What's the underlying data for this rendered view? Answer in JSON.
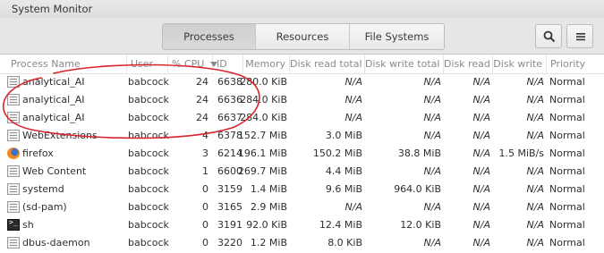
{
  "window": {
    "title": "System Monitor"
  },
  "tabs": [
    {
      "label": "Processes",
      "active": true
    },
    {
      "label": "Resources",
      "active": false
    },
    {
      "label": "File Systems",
      "active": false
    }
  ],
  "toolbar": {
    "search_icon": "search-icon",
    "menu_icon": "hamburger-menu-icon"
  },
  "columns": {
    "name": "Process Name",
    "user": "User",
    "cpu": "% CPU",
    "cpu_sort_icon": "sort-desc-icon",
    "id": "ID",
    "memory": "Memory",
    "disk_read_total": "Disk read total",
    "disk_write_total": "Disk write total",
    "disk_read": "Disk read",
    "disk_write": "Disk write",
    "priority": "Priority"
  },
  "processes": [
    {
      "icon": "generic-app-icon",
      "name": "analytical_AI",
      "user": "babcock",
      "cpu": "24",
      "id": "6638",
      "memory": "280.0 KiB",
      "disk_read_total": "N/A",
      "disk_write_total": "N/A",
      "disk_read": "N/A",
      "disk_write": "N/A",
      "priority": "Normal"
    },
    {
      "icon": "generic-app-icon",
      "name": "analytical_AI",
      "user": "babcock",
      "cpu": "24",
      "id": "6636",
      "memory": "284.0 KiB",
      "disk_read_total": "N/A",
      "disk_write_total": "N/A",
      "disk_read": "N/A",
      "disk_write": "N/A",
      "priority": "Normal"
    },
    {
      "icon": "generic-app-icon",
      "name": "analytical_AI",
      "user": "babcock",
      "cpu": "24",
      "id": "6637",
      "memory": "284.0 KiB",
      "disk_read_total": "N/A",
      "disk_write_total": "N/A",
      "disk_read": "N/A",
      "disk_write": "N/A",
      "priority": "Normal"
    },
    {
      "icon": "generic-app-icon",
      "name": "WebExtensions",
      "user": "babcock",
      "cpu": "4",
      "id": "6378",
      "memory": "152.7 MiB",
      "disk_read_total": "3.0 MiB",
      "disk_write_total": "N/A",
      "disk_read": "N/A",
      "disk_write": "N/A",
      "priority": "Normal"
    },
    {
      "icon": "firefox-icon",
      "name": "firefox",
      "user": "babcock",
      "cpu": "3",
      "id": "6214",
      "memory": "196.1 MiB",
      "disk_read_total": "150.2 MiB",
      "disk_write_total": "38.8 MiB",
      "disk_read": "N/A",
      "disk_write": "1.5 MiB/s",
      "priority": "Normal"
    },
    {
      "icon": "generic-app-icon",
      "name": "Web Content",
      "user": "babcock",
      "cpu": "1",
      "id": "6600",
      "memory": "269.7 MiB",
      "disk_read_total": "4.4 MiB",
      "disk_write_total": "N/A",
      "disk_read": "N/A",
      "disk_write": "N/A",
      "priority": "Normal"
    },
    {
      "icon": "generic-app-icon",
      "name": "systemd",
      "user": "babcock",
      "cpu": "0",
      "id": "3159",
      "memory": "1.4 MiB",
      "disk_read_total": "9.6 MiB",
      "disk_write_total": "964.0 KiB",
      "disk_read": "N/A",
      "disk_write": "N/A",
      "priority": "Normal"
    },
    {
      "icon": "generic-app-icon",
      "name": "(sd-pam)",
      "user": "babcock",
      "cpu": "0",
      "id": "3165",
      "memory": "2.9 MiB",
      "disk_read_total": "N/A",
      "disk_write_total": "N/A",
      "disk_read": "N/A",
      "disk_write": "N/A",
      "priority": "Normal"
    },
    {
      "icon": "terminal-icon",
      "name": "sh",
      "user": "babcock",
      "cpu": "0",
      "id": "3191",
      "memory": "92.0 KiB",
      "disk_read_total": "12.4 MiB",
      "disk_write_total": "12.0 KiB",
      "disk_read": "N/A",
      "disk_write": "N/A",
      "priority": "Normal"
    },
    {
      "icon": "generic-app-icon",
      "name": "dbus-daemon",
      "user": "babcock",
      "cpu": "0",
      "id": "3220",
      "memory": "1.2 MiB",
      "disk_read_total": "8.0 KiB",
      "disk_write_total": "N/A",
      "disk_read": "N/A",
      "disk_write": "N/A",
      "priority": "Normal"
    }
  ],
  "annotation": {
    "shape": "hand-drawn-ellipse",
    "color": "#d9242c",
    "encloses": "analytical_AI rows"
  }
}
